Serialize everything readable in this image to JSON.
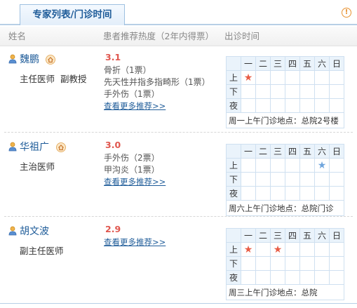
{
  "header": {
    "tab_label": "专家列表/门诊时间",
    "info_icon": "!"
  },
  "columns": {
    "name": "姓名",
    "popularity": "患者推荐热度（2年内得票）",
    "schedule": "出诊时间"
  },
  "weekdays": [
    "一",
    "二",
    "三",
    "四",
    "五",
    "六",
    "日"
  ],
  "periods": [
    "上",
    "下",
    "夜"
  ],
  "star_char": "★",
  "doctors": [
    {
      "name": "魏鹏",
      "title": "主任医师  副教授",
      "has_home_icon": true,
      "score": "3.1",
      "recommendations": [
        "骨折（1票）",
        "先天性并指多指畸形（1票）",
        "手外伤（1票）"
      ],
      "more_link": "查看更多推荐>>",
      "schedule_marks": [
        {
          "period": 0,
          "day": 0,
          "color": "red"
        }
      ],
      "location": "周一上午门诊地点：总院2号楼"
    },
    {
      "name": "华祖广",
      "title": "主治医师",
      "has_home_icon": true,
      "score": "3.0",
      "recommendations": [
        "手外伤（2票）",
        "甲沟炎（1票）"
      ],
      "more_link": "查看更多推荐>>",
      "schedule_marks": [
        {
          "period": 0,
          "day": 5,
          "color": "blue"
        }
      ],
      "location": "周六上午门诊地点：总院门诊"
    },
    {
      "name": "胡文波",
      "title": "副主任医师",
      "has_home_icon": false,
      "score": "2.9",
      "recommendations": [],
      "more_link": "查看更多推荐>>",
      "schedule_marks": [
        {
          "period": 0,
          "day": 0,
          "color": "red"
        },
        {
          "period": 0,
          "day": 2,
          "color": "red"
        }
      ],
      "location": "周三上午门诊地点：总院"
    }
  ],
  "colors": {
    "link": "#1f5c99",
    "score": "#e0574f",
    "star_red": "#e85c45",
    "star_blue": "#6fa5dd"
  }
}
